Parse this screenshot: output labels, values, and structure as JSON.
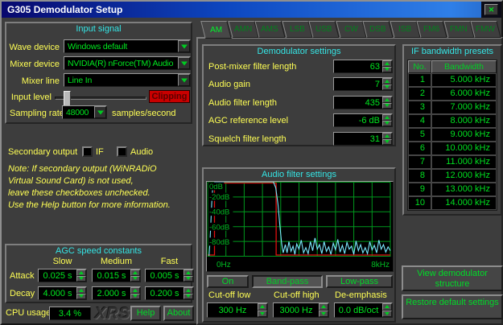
{
  "window": {
    "title": "G305 Demodulator Setup"
  },
  "icons": {
    "close": "✕"
  },
  "input_signal": {
    "title": "Input signal",
    "wave_device_label": "Wave device",
    "wave_device_value": "Windows default",
    "mixer_device_label": "Mixer device",
    "mixer_device_value": "NVIDIA(R) nForce(TM) Audio",
    "mixer_line_label": "Mixer line",
    "mixer_line_value": "Line In",
    "input_level_label": "Input level",
    "clipping_label": "Clipping",
    "input_level_pct": 9,
    "sampling_rate_label": "Sampling rate",
    "sampling_rate_value": "48000",
    "sampling_rate_suffix": "samples/second"
  },
  "secondary_output": {
    "label": "Secondary output",
    "if_label": "IF",
    "audio_label": "Audio",
    "if_checked": false,
    "audio_checked": false
  },
  "note_lines": [
    "Note: If secondary output (WiNRADiO",
    "Virtual Sound Card) is not used,",
    "leave these checkboxes unchecked.",
    "Use the Help button for more information."
  ],
  "agc": {
    "title": "AGC speed constants",
    "columns": [
      "Slow",
      "Medium",
      "Fast"
    ],
    "attack_label": "Attack",
    "attack_values": [
      "0.025 s",
      "0.015 s",
      "0.005 s"
    ],
    "decay_label": "Decay",
    "decay_values": [
      "4.000 s",
      "2.000 s",
      "0.200 s"
    ]
  },
  "footer": {
    "cpu_label": "CPU usage",
    "cpu_value": "3.4 %",
    "logo": "XRS",
    "help_label": "Help",
    "about_label": "About"
  },
  "tabs": [
    {
      "label": "AM",
      "active": true
    },
    {
      "label": "AMN",
      "active": false
    },
    {
      "label": "AMS",
      "active": false
    },
    {
      "label": "LSB",
      "active": false
    },
    {
      "label": "USB",
      "active": false
    },
    {
      "label": "CW",
      "active": false
    },
    {
      "label": "DSB",
      "active": false
    },
    {
      "label": "ISB",
      "active": false
    },
    {
      "label": "FM6",
      "active": false
    },
    {
      "label": "FMN",
      "active": false
    },
    {
      "label": "FMW",
      "active": false
    }
  ],
  "demod_settings": {
    "title": "Demodulator settings",
    "fields": [
      {
        "label": "Post-mixer filter length",
        "value": "63"
      },
      {
        "label": "Audio gain",
        "value": "7"
      },
      {
        "label": "Audio filter length",
        "value": "435"
      },
      {
        "label": "AGC reference level",
        "value": "-6 dB"
      },
      {
        "label": "Squelch filter length",
        "value": "31"
      }
    ]
  },
  "audio_filter": {
    "title": "Audio filter settings",
    "graph": {
      "type": "line",
      "x_min_hz": 0,
      "x_max_hz": 8000,
      "y_min_db": -100,
      "y_max_db": 0,
      "y_tick_labels": [
        "0dB",
        "-20dB",
        "-40dB",
        "-60dB",
        "-80dB"
      ],
      "y_tick_db": [
        0,
        -20,
        -40,
        -60,
        -80
      ],
      "x_labels": [
        "0Hz",
        "8kHz"
      ],
      "grid_cols": 10,
      "grid_rows": 5,
      "grid_color": "#00991e",
      "bg_color": "#000000",
      "mask": {
        "color": "#e01010",
        "low_hz": 300,
        "high_hz": 3000
      },
      "response_color": "#7be9ff",
      "response_points": [
        [
          60,
          -100
        ],
        [
          100,
          -82
        ],
        [
          140,
          -55
        ],
        [
          180,
          -28
        ],
        [
          220,
          -10
        ],
        [
          260,
          -2
        ],
        [
          320,
          0
        ],
        [
          2880,
          0
        ],
        [
          2980,
          -8
        ],
        [
          3080,
          -30
        ],
        [
          3160,
          -58
        ],
        [
          3240,
          -82
        ],
        [
          3310,
          -95
        ],
        [
          3400,
          -84
        ],
        [
          3480,
          -95
        ],
        [
          3560,
          -80
        ],
        [
          3650,
          -93
        ],
        [
          3740,
          -86
        ],
        [
          3820,
          -97
        ],
        [
          3900,
          -83
        ],
        [
          4000,
          -90
        ],
        [
          4100,
          -78
        ],
        [
          4200,
          -95
        ],
        [
          4300,
          -88
        ],
        [
          4400,
          -96
        ],
        [
          4500,
          -80
        ],
        [
          4600,
          -92
        ],
        [
          4700,
          -75
        ],
        [
          4800,
          -90
        ],
        [
          4900,
          -84
        ],
        [
          5000,
          -96
        ],
        [
          5100,
          -80
        ],
        [
          5200,
          -93
        ],
        [
          5300,
          -87
        ],
        [
          5400,
          -97
        ],
        [
          5500,
          -82
        ],
        [
          5600,
          -91
        ],
        [
          5700,
          -77
        ],
        [
          5800,
          -94
        ],
        [
          5900,
          -85
        ],
        [
          6000,
          -96
        ],
        [
          6100,
          -81
        ],
        [
          6200,
          -90
        ],
        [
          6300,
          -86
        ],
        [
          6400,
          -97
        ],
        [
          6500,
          -79
        ],
        [
          6600,
          -92
        ],
        [
          6700,
          -84
        ],
        [
          6800,
          -95
        ],
        [
          6900,
          -88
        ],
        [
          7000,
          -96
        ],
        [
          7100,
          -80
        ],
        [
          7200,
          -91
        ],
        [
          7300,
          -85
        ],
        [
          7400,
          -95
        ],
        [
          7500,
          -78
        ],
        [
          7600,
          -90
        ],
        [
          7700,
          -84
        ],
        [
          7800,
          -94
        ],
        [
          7900,
          -87
        ],
        [
          8000,
          -92
        ]
      ]
    },
    "mode_buttons": [
      {
        "label": "On",
        "pressed": false
      },
      {
        "label": "Band-pass",
        "pressed": true
      },
      {
        "label": "Low-pass",
        "pressed": false
      }
    ],
    "cutoff_low_label": "Cut-off low",
    "cutoff_low_value": "300 Hz",
    "cutoff_high_label": "Cut-off high",
    "cutoff_high_value": "3000 Hz",
    "deemphasis_label": "De-emphasis",
    "deemphasis_value": "0.0 dB/oct"
  },
  "if_presets": {
    "title": "IF bandwidth presets",
    "headers": [
      "No.",
      "Bandwidth"
    ],
    "rows": [
      [
        "1",
        "5.000 kHz"
      ],
      [
        "2",
        "6.000 kHz"
      ],
      [
        "3",
        "7.000 kHz"
      ],
      [
        "4",
        "8.000 kHz"
      ],
      [
        "5",
        "9.000 kHz"
      ],
      [
        "6",
        "10.000 kHz"
      ],
      [
        "7",
        "11.000 kHz"
      ],
      [
        "8",
        "12.000 kHz"
      ],
      [
        "9",
        "13.000 kHz"
      ],
      [
        "10",
        "14.000 kHz"
      ]
    ]
  },
  "buttons": {
    "view_demod": "View demodulator structure",
    "restore_defaults": "Restore default settings"
  },
  "colors": {
    "accent_green": "#00e81f",
    "label_yellow": "#ffff55",
    "title_cyan": "#35e6e6",
    "clipping_red": "#c80000",
    "titlebar_blue": "#0d47c0",
    "inactive_tab_green": "#00821c"
  }
}
